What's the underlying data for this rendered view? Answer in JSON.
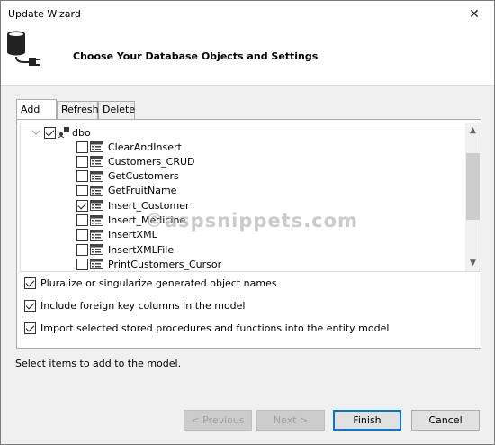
{
  "window": {
    "title": "Update Wizard",
    "close_glyph": "✕"
  },
  "header": {
    "title": "Choose Your Database Objects and Settings",
    "icon": "database-connect-icon"
  },
  "tabs": [
    {
      "label": "Add",
      "active": true
    },
    {
      "label": "Refresh",
      "active": false
    },
    {
      "label": "Delete",
      "active": false
    }
  ],
  "tree": {
    "root": {
      "label": "dbo",
      "checked": true
    },
    "items": [
      {
        "label": "ClearAndInsert",
        "checked": false
      },
      {
        "label": "Customers_CRUD",
        "checked": false
      },
      {
        "label": "GetCustomers",
        "checked": false
      },
      {
        "label": "GetFruitName",
        "checked": false
      },
      {
        "label": "Insert_Customer",
        "checked": true
      },
      {
        "label": "Insert_Medicine",
        "checked": false
      },
      {
        "label": "InsertXML",
        "checked": false
      },
      {
        "label": "InsertXMLFile",
        "checked": false
      },
      {
        "label": "PrintCustomers_Cursor",
        "checked": false
      }
    ]
  },
  "options": {
    "pluralize": {
      "label": "Pluralize or singularize generated object names",
      "checked": true
    },
    "foreign_keys": {
      "label": "Include foreign key columns in the model",
      "checked": true
    },
    "import_procs": {
      "label": "Import selected stored procedures and functions into the entity model",
      "checked": true
    }
  },
  "status_text": "Select items to add to the model.",
  "watermark": "©aspsnippets.com",
  "buttons": {
    "previous": "< Previous",
    "next": "Next >",
    "finish": "Finish",
    "cancel": "Cancel"
  },
  "colors": {
    "accent": "#0078d7",
    "background": "#f0f0f0"
  }
}
